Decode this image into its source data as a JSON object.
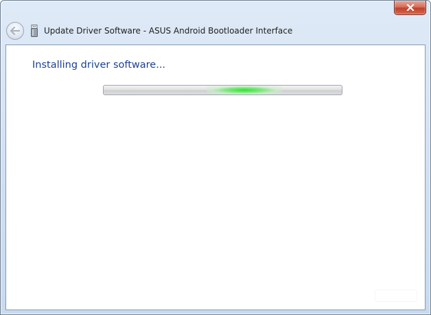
{
  "window": {
    "title": "Update Driver Software - ASUS Android Bootloader Interface"
  },
  "content": {
    "heading": "Installing driver software..."
  },
  "icons": {
    "back": "back-arrow-icon",
    "device": "usb-device-icon",
    "close": "close-icon"
  },
  "colors": {
    "heading": "#1d3f93",
    "close_button": "#c0412c",
    "progress_glow": "#2ee32e"
  }
}
